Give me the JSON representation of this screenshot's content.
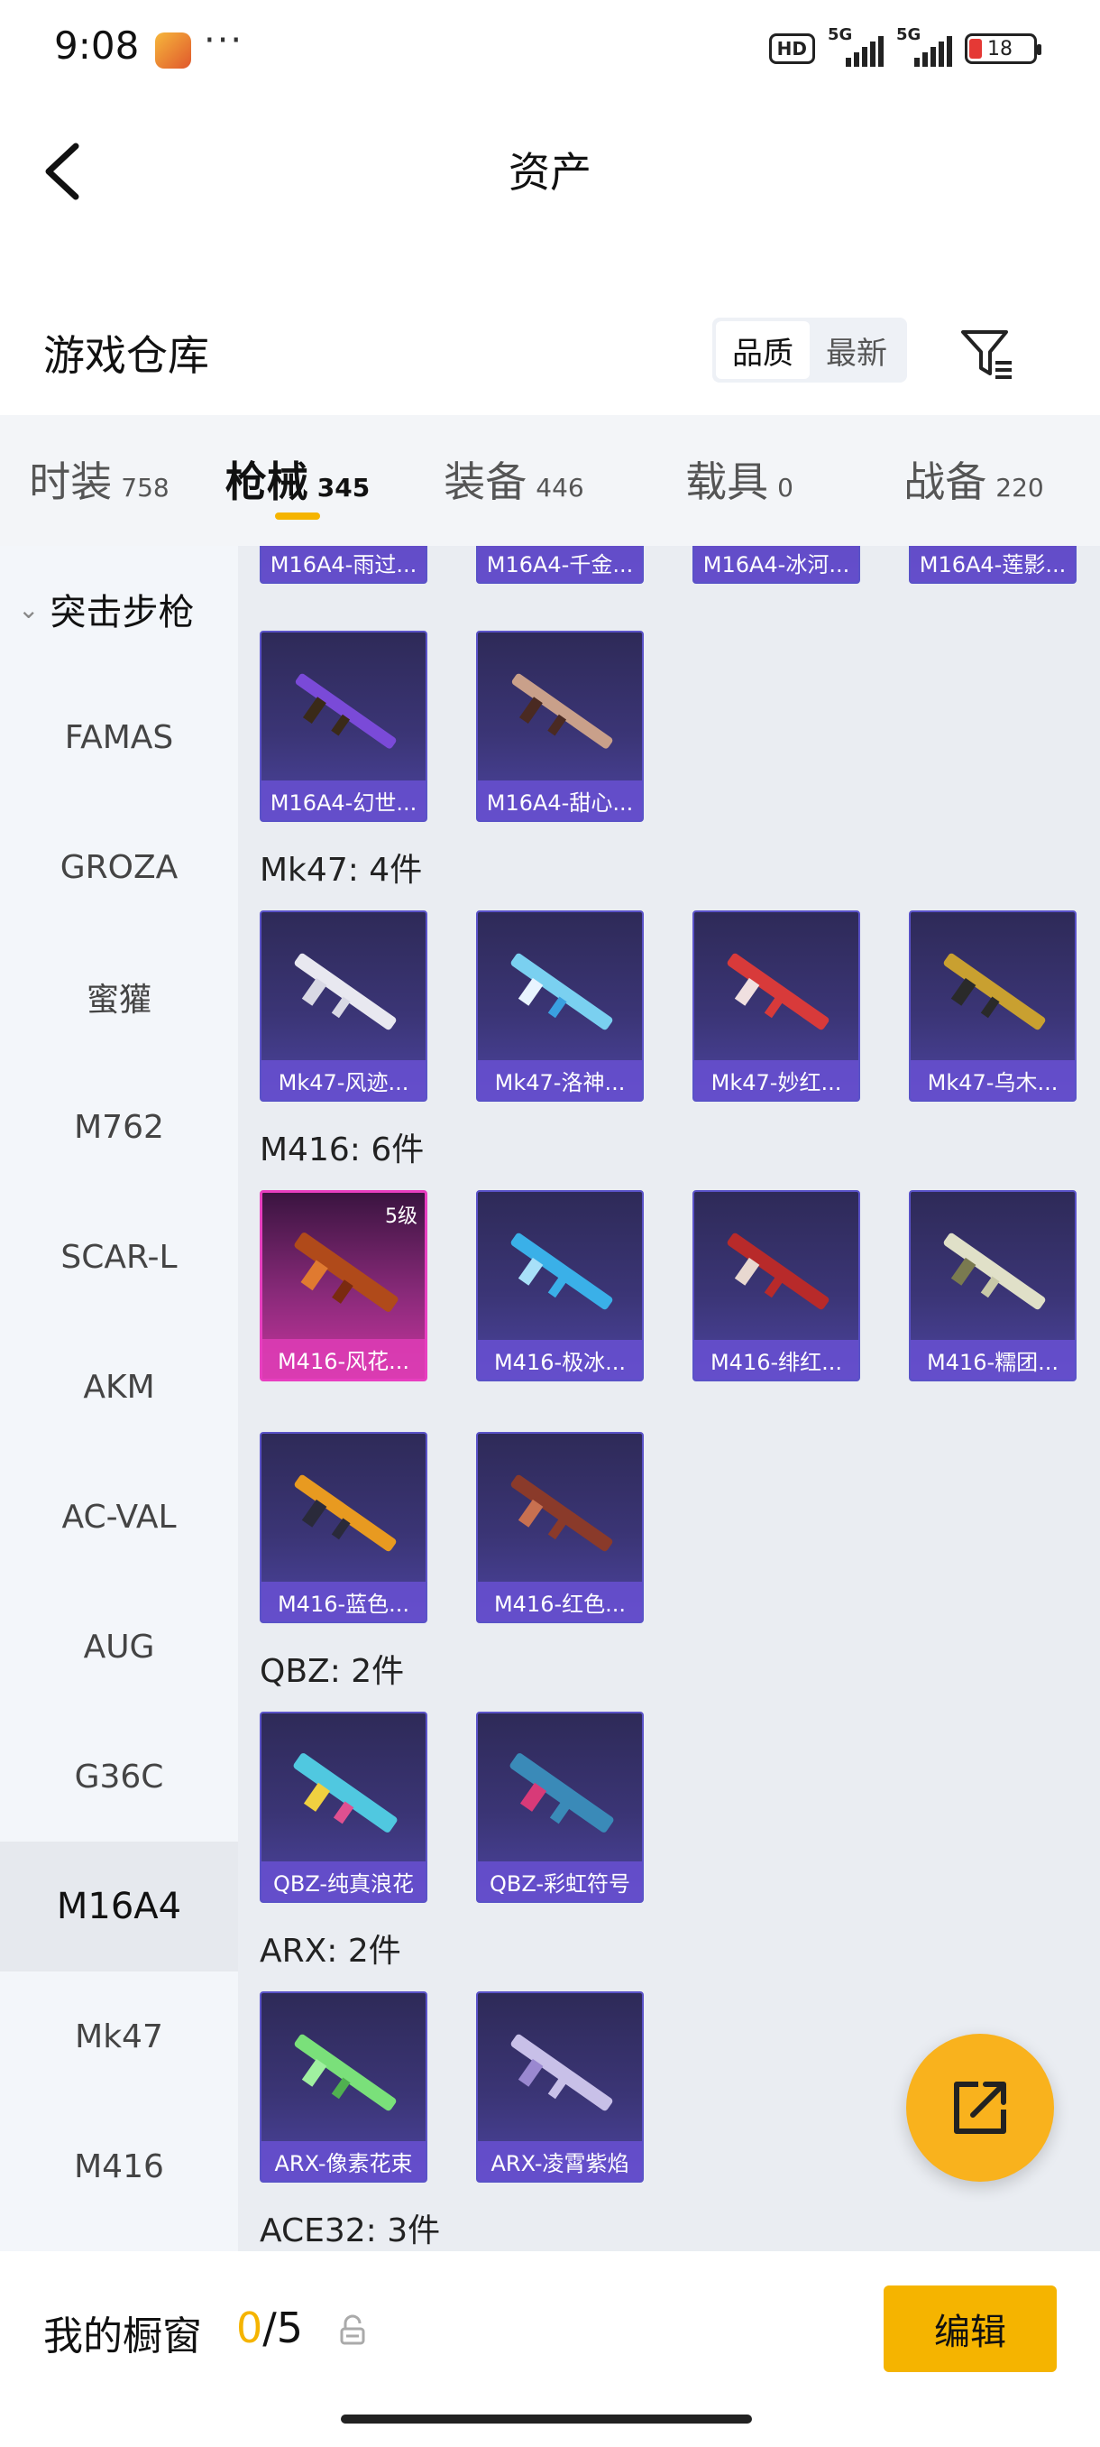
{
  "status_bar": {
    "time": "9:08",
    "dots": "···",
    "hd": "HD",
    "net1": "5G",
    "net2": "5G",
    "battery": "18"
  },
  "header": {
    "title": "资产"
  },
  "warehouse": {
    "title": "游戏仓库",
    "sort_options": [
      "品质",
      "最新"
    ],
    "active_sort": "品质"
  },
  "tabs": [
    {
      "name": "时装",
      "count": "758"
    },
    {
      "name": "枪械",
      "count": "345",
      "active": true
    },
    {
      "name": "装备",
      "count": "446"
    },
    {
      "name": "载具",
      "count": "0"
    },
    {
      "name": "战备",
      "count": "220"
    }
  ],
  "sidebar": {
    "header": "突击步枪",
    "items": [
      "FAMAS",
      "GROZA",
      "蜜獾",
      "M762",
      "SCAR-L",
      "AKM",
      "AC-VAL",
      "AUG",
      "G36C",
      "M16A4",
      "Mk47",
      "M416"
    ],
    "active": "M16A4"
  },
  "groups": [
    {
      "label": "",
      "items": [
        "M16A4-雨过...",
        "M16A4-千金...",
        "M16A4-冰河...",
        "M16A4-莲影...",
        "M16A4-幻世...",
        "M16A4-甜心..."
      ]
    },
    {
      "label": "Mk47: 4件",
      "items": [
        "Mk47-风迹...",
        "Mk47-洛神...",
        "Mk47-妙红...",
        "Mk47-乌木..."
      ]
    },
    {
      "label": "M416: 6件",
      "items": [
        "M416-风花...",
        "M416-极冰...",
        "M416-绯红...",
        "M416-糯团...",
        "M416-蓝色...",
        "M416-红色..."
      ],
      "level": "5级"
    },
    {
      "label": "QBZ: 2件",
      "items": [
        "QBZ-纯真浪花",
        "QBZ-彩虹符号"
      ]
    },
    {
      "label": "ARX: 2件",
      "items": [
        "ARX-像素花束",
        "ARX-凌霄紫焰"
      ]
    },
    {
      "label": "ACE32: 3件",
      "items": []
    }
  ],
  "bottom": {
    "window_label": "我的橱窗",
    "current": "0",
    "separator": "/",
    "max": "5",
    "edit_label": "编辑"
  },
  "colors": {
    "accent": "#f5b400",
    "card_purple": "#3b3576",
    "card_gold": "#c8359e"
  }
}
